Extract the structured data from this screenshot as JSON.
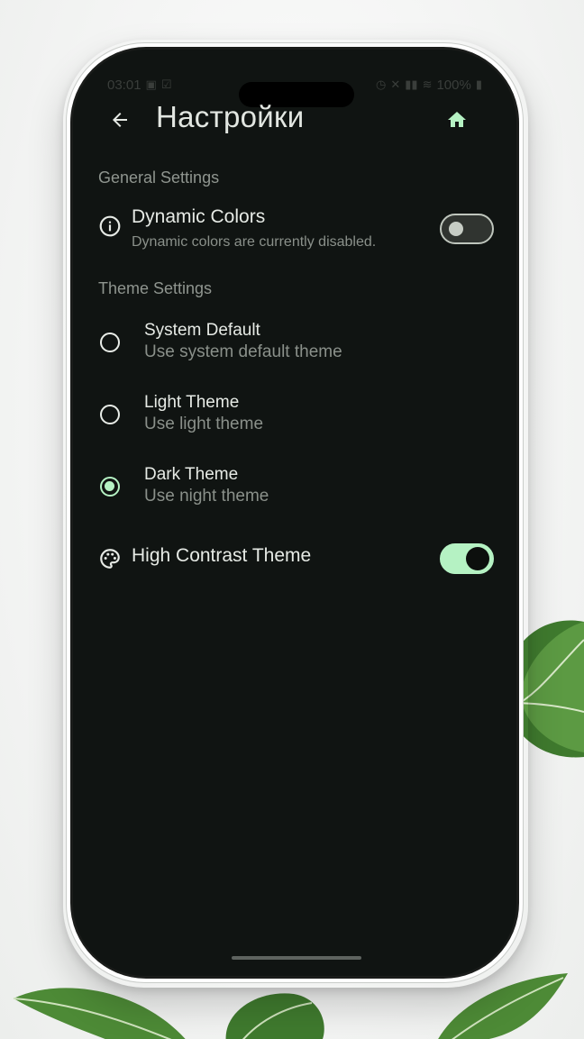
{
  "status_bar": {
    "time": "03:01",
    "battery": "100%"
  },
  "topbar": {
    "title": "Настройки",
    "back_icon": "arrow-back-icon",
    "home_icon": "home-icon"
  },
  "sections": {
    "general": {
      "header": "General Settings",
      "dynamic_colors": {
        "title": "Dynamic Colors",
        "subtitle": "Dynamic colors are currently disabled.",
        "icon": "info-icon",
        "enabled": false
      }
    },
    "theme": {
      "header": "Theme Settings",
      "options": [
        {
          "title": "System Default",
          "subtitle": "Use system default theme",
          "selected": false
        },
        {
          "title": "Light Theme",
          "subtitle": "Use light theme",
          "selected": false
        },
        {
          "title": "Dark Theme",
          "subtitle": "Use night theme",
          "selected": true
        }
      ],
      "high_contrast": {
        "title": "High Contrast Theme",
        "icon": "palette-icon",
        "enabled": true
      }
    }
  },
  "colors": {
    "background": "#101412",
    "accent": "#b5f2c3",
    "text_primary": "#e6eae5",
    "text_secondary": "#8a908a"
  }
}
